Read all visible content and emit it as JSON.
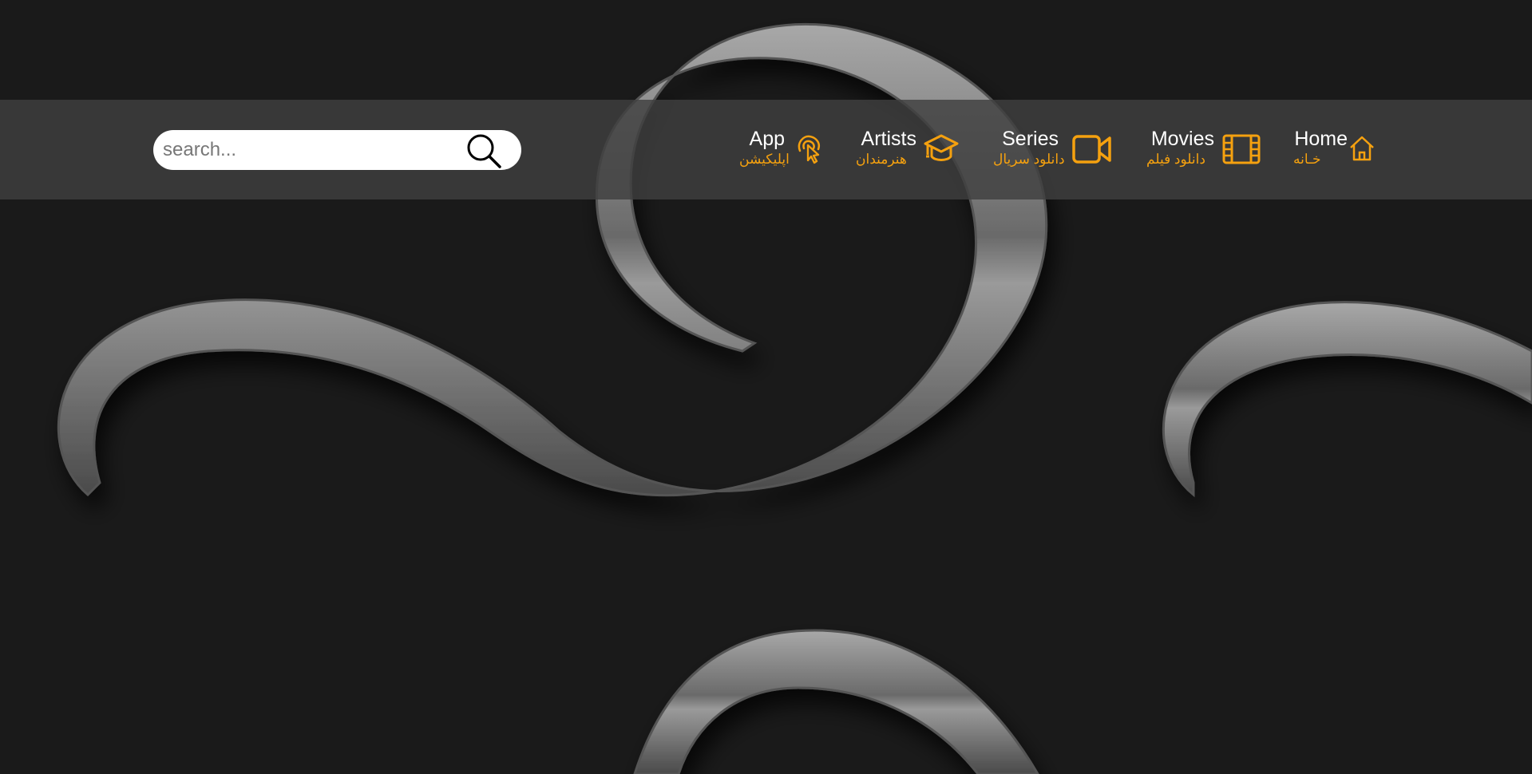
{
  "search": {
    "placeholder": "search..."
  },
  "nav": {
    "items": [
      {
        "label": "Home",
        "sub": "خـانه",
        "icon": "home-icon"
      },
      {
        "label": "Movies",
        "sub": "دانلود فیلم",
        "icon": "film-icon"
      },
      {
        "label": "Series",
        "sub": "دانلود سریال",
        "icon": "video-camera-icon"
      },
      {
        "label": "Artists",
        "sub": "هنرمندان",
        "icon": "graduation-cap-icon"
      },
      {
        "label": "App",
        "sub": "اپلیکیشن",
        "icon": "touch-pointer-icon"
      }
    ]
  },
  "colors": {
    "accent": "#f5a10f",
    "background": "#1a1a1a",
    "navbar": "#404040",
    "text": "#ffffff"
  }
}
